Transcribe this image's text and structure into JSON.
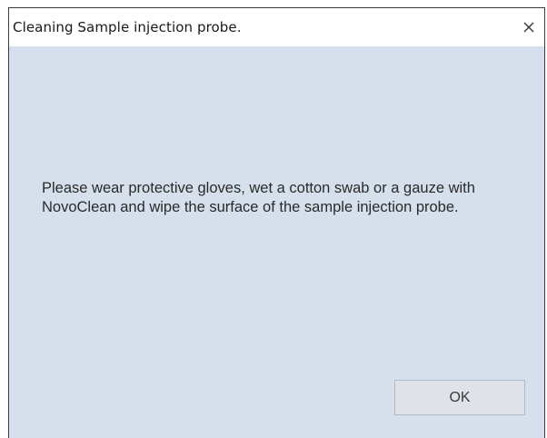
{
  "window": {
    "title": "Cleaning Sample injection probe.",
    "close_icon": "close-icon"
  },
  "dialog": {
    "message": "Please wear protective gloves, wet a cotton swab or a gauze with NovoClean and wipe the surface of the sample injection probe.",
    "ok_label": "OK"
  },
  "colors": {
    "client_background": "#d6e0ed",
    "button_background": "#dfe3e9",
    "text": "#2a2a2a"
  }
}
